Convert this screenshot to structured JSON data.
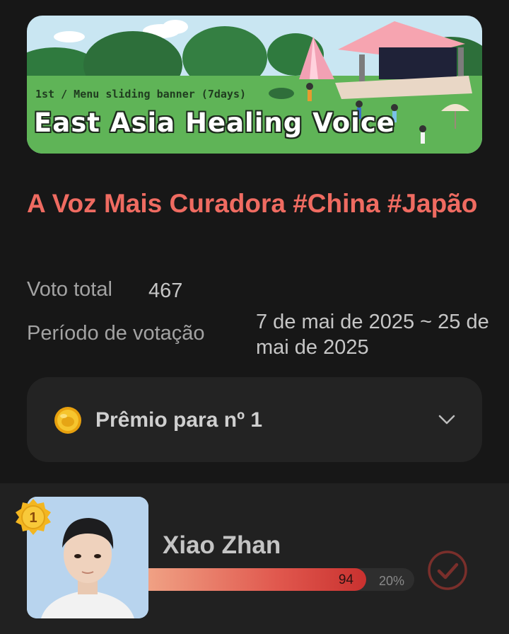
{
  "banner": {
    "caption": "1st / Menu sliding banner (7days)",
    "title": "East Asia Healing Voice"
  },
  "event": {
    "title": "A Voz Mais Curadora #China #Japão",
    "total_label": "Voto total",
    "total_value": "467",
    "period_label": "Período de votação",
    "period_value": "7 de mai de 2025 ~ 25 de mai de 2025"
  },
  "prize": {
    "label": "Prêmio para nº 1",
    "icon": "coin-icon",
    "expand_icon": "chevron-down-icon"
  },
  "candidates": [
    {
      "rank": "1",
      "name": "Xiao Zhan",
      "votes": "94",
      "percent": "20%",
      "share": 0.82,
      "vote_icon": "check-circle-icon"
    }
  ],
  "colors": {
    "accent": "#ef6b61",
    "background": "#171717",
    "card": "#232323",
    "gold": "#f2b91c"
  }
}
